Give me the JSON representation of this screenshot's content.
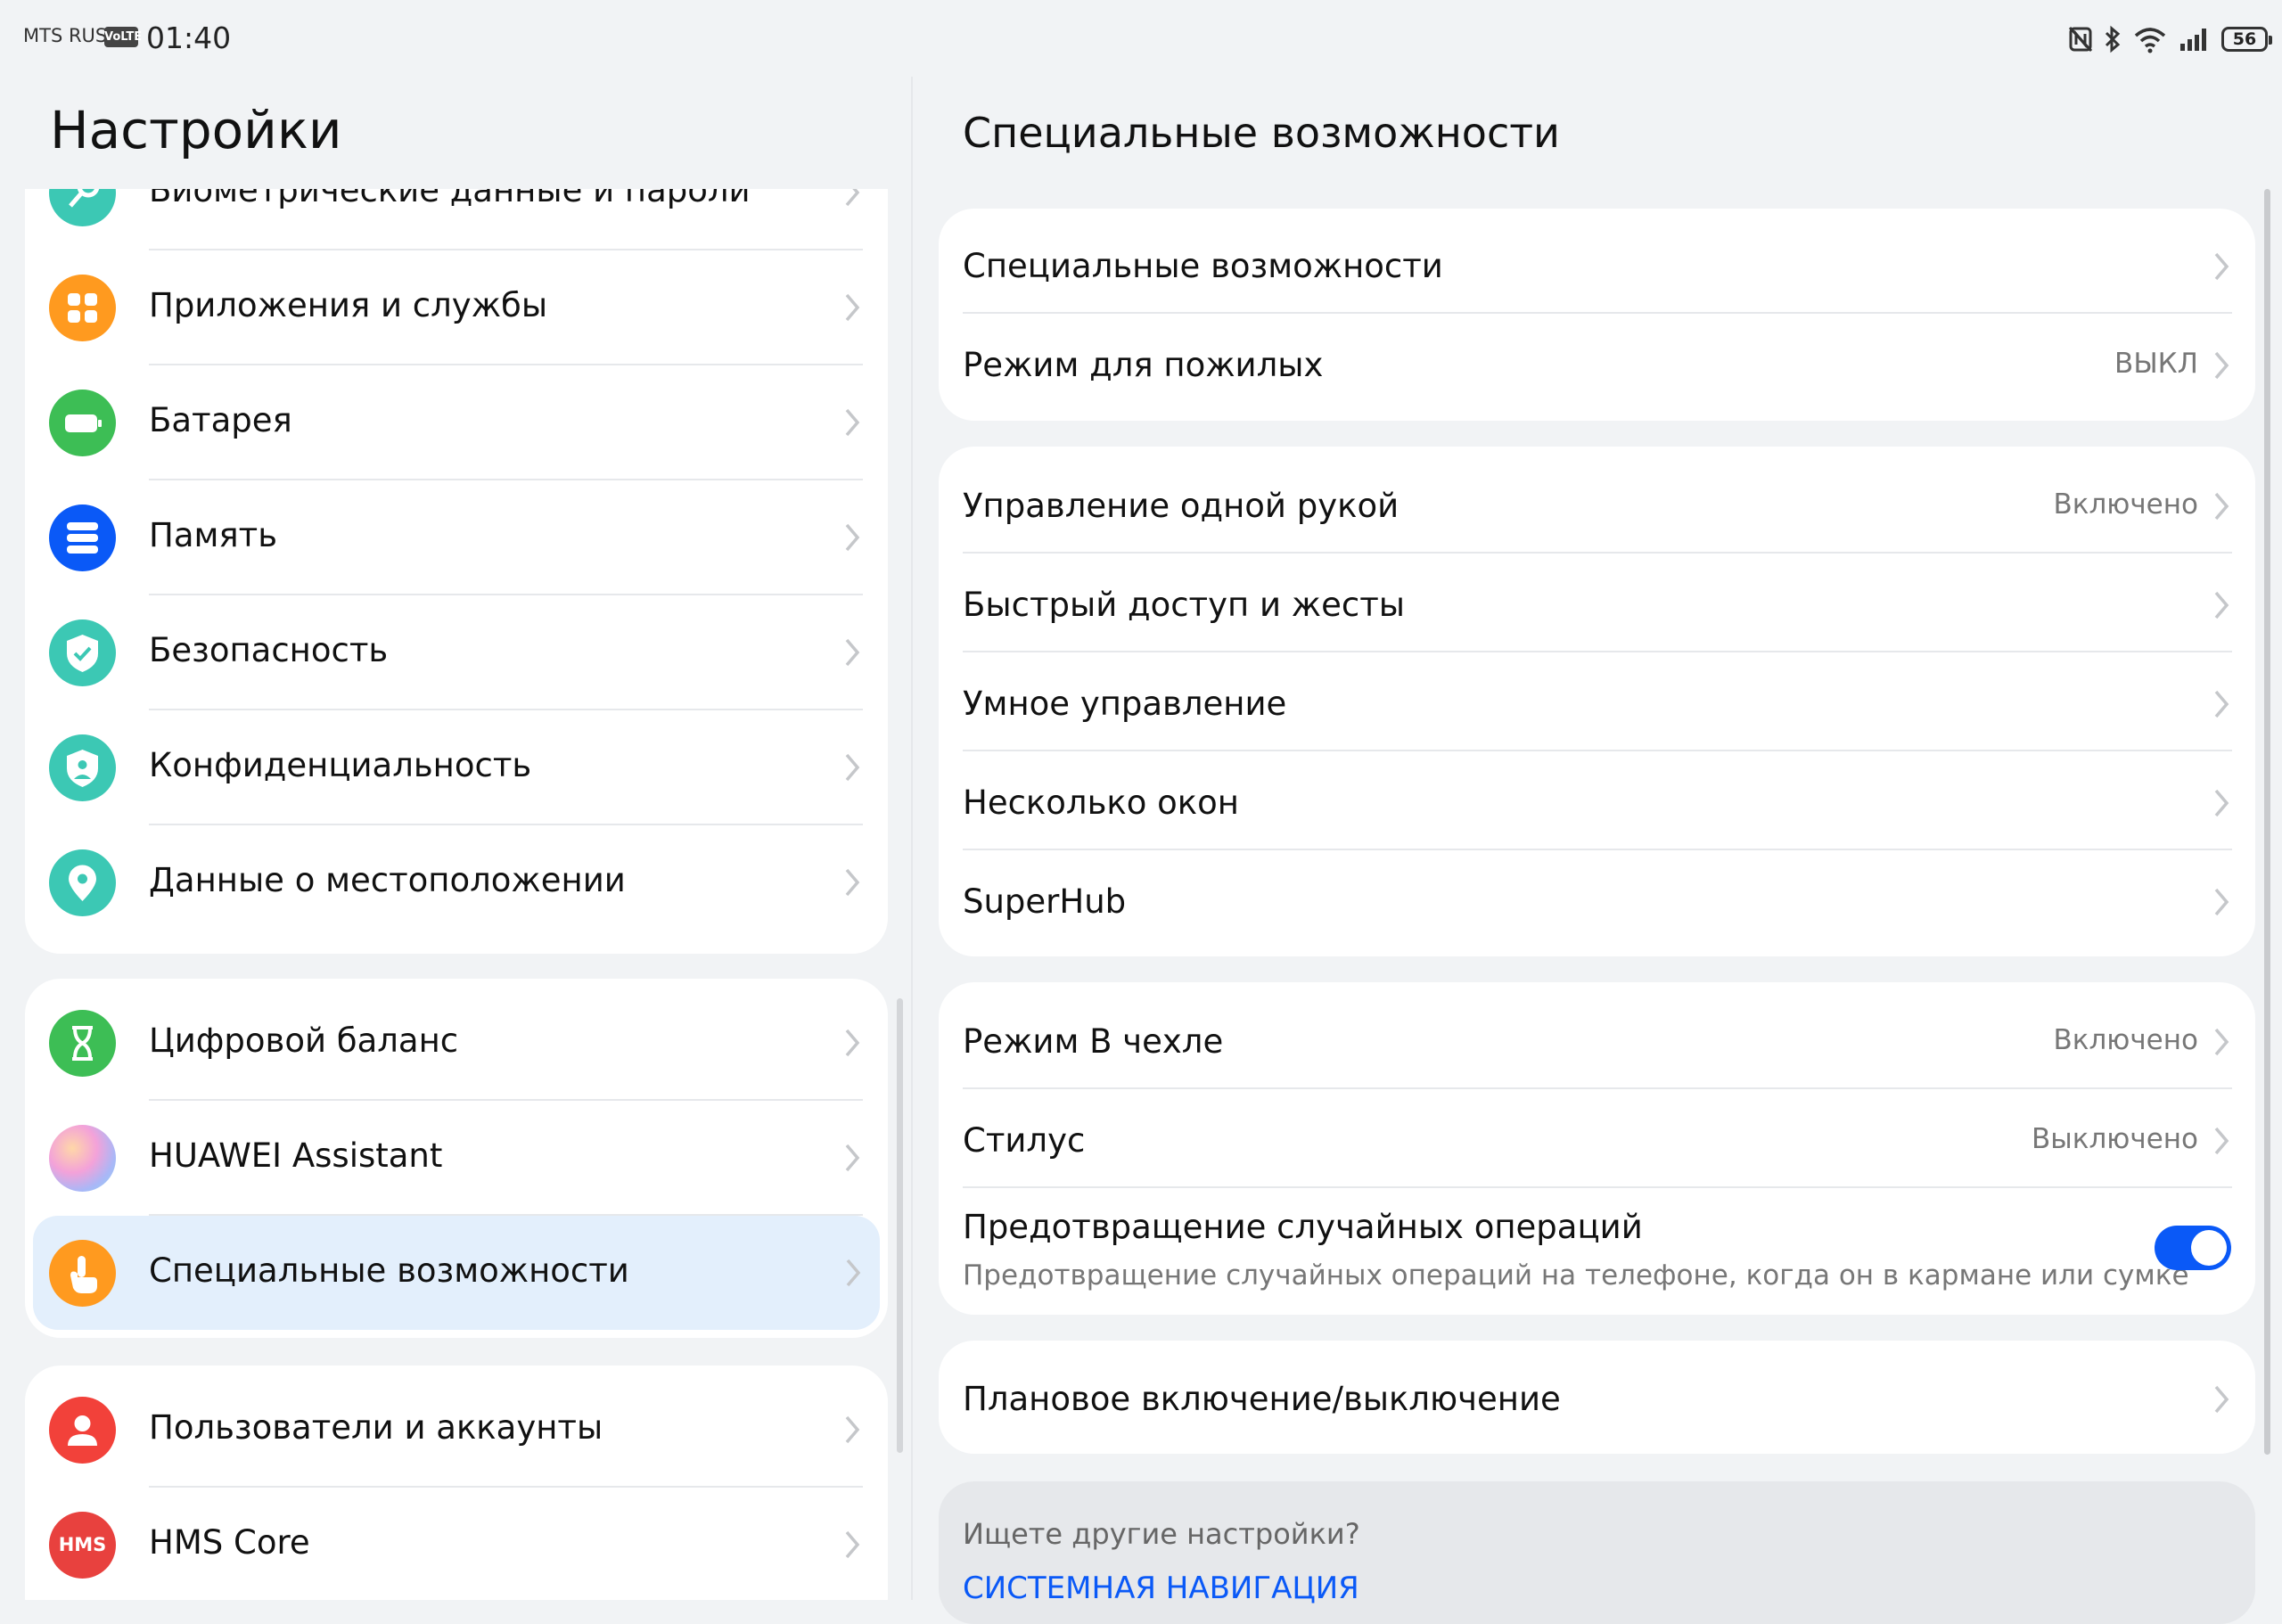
{
  "status_bar": {
    "carrier": "MTS RUS",
    "volte": "VoLTE",
    "time": "01:40",
    "battery": "56",
    "icons": [
      "nfc-icon",
      "bluetooth-icon",
      "wifi-icon",
      "signal-icon",
      "battery-icon"
    ]
  },
  "left": {
    "title": "Настройки",
    "groups": [
      {
        "items": [
          {
            "label": "Биометрические данные и пароли",
            "icon": "key-icon",
            "color": "#3CC8B4"
          },
          {
            "label": "Приложения и службы",
            "icon": "apps-icon",
            "color": "#FF9A1F"
          },
          {
            "label": "Батарея",
            "icon": "battery-icon",
            "color": "#3DBE55"
          },
          {
            "label": "Память",
            "icon": "storage-icon",
            "color": "#0A59F7"
          },
          {
            "label": "Безопасность",
            "icon": "shield-check-icon",
            "color": "#3CC8B4"
          },
          {
            "label": "Конфиденциальность",
            "icon": "privacy-shield-icon",
            "color": "#3CC8B4"
          },
          {
            "label": "Данные о местоположении",
            "icon": "location-pin-icon",
            "color": "#3CC8B4"
          }
        ]
      },
      {
        "items": [
          {
            "label": "Цифровой баланс",
            "icon": "hourglass-icon",
            "color": "#3DBE55"
          },
          {
            "label": "HUAWEI Assistant",
            "icon": "assistant-orb-icon",
            "color": "#E7A7E6"
          },
          {
            "label": "Специальные возможности",
            "icon": "hand-tap-icon",
            "color": "#FF9A1F",
            "selected": true
          }
        ]
      },
      {
        "items": [
          {
            "label": "Пользователи и аккаунты",
            "icon": "user-icon",
            "color": "#F2413A"
          },
          {
            "label": "HMS Core",
            "icon": "hms-icon",
            "color": "#E8413E",
            "icon_text": "HMS"
          }
        ]
      }
    ]
  },
  "right": {
    "title": "Специальные возможности",
    "groups": [
      {
        "items": [
          {
            "label": "Специальные возможности",
            "value": ""
          },
          {
            "label": "Режим для пожилых",
            "value": "ВЫКЛ"
          }
        ]
      },
      {
        "items": [
          {
            "label": "Управление одной рукой",
            "value": "Включено"
          },
          {
            "label": "Быстрый доступ и жесты",
            "value": ""
          },
          {
            "label": "Умное управление",
            "value": ""
          },
          {
            "label": "Несколько окон",
            "value": ""
          },
          {
            "label": "SuperHub",
            "value": ""
          }
        ]
      },
      {
        "items": [
          {
            "label": "Режим В чехле",
            "value": "Включено"
          },
          {
            "label": "Стилус",
            "value": "Выключено"
          },
          {
            "label": "Предотвращение случайных операций",
            "subtitle": "Предотвращение случайных операций на телефоне, когда он в кармане или сумке",
            "toggle": true
          }
        ]
      },
      {
        "items": [
          {
            "label": "Плановое включение/выключение",
            "value": ""
          }
        ]
      }
    ],
    "search_prompt": "Ищете другие настройки?",
    "search_link": "СИСТЕМНАЯ НАВИГАЦИЯ"
  },
  "colors": {
    "accent": "#0A59F7",
    "selected_bg": "#E3EFFC",
    "background": "#F1F3F5"
  }
}
